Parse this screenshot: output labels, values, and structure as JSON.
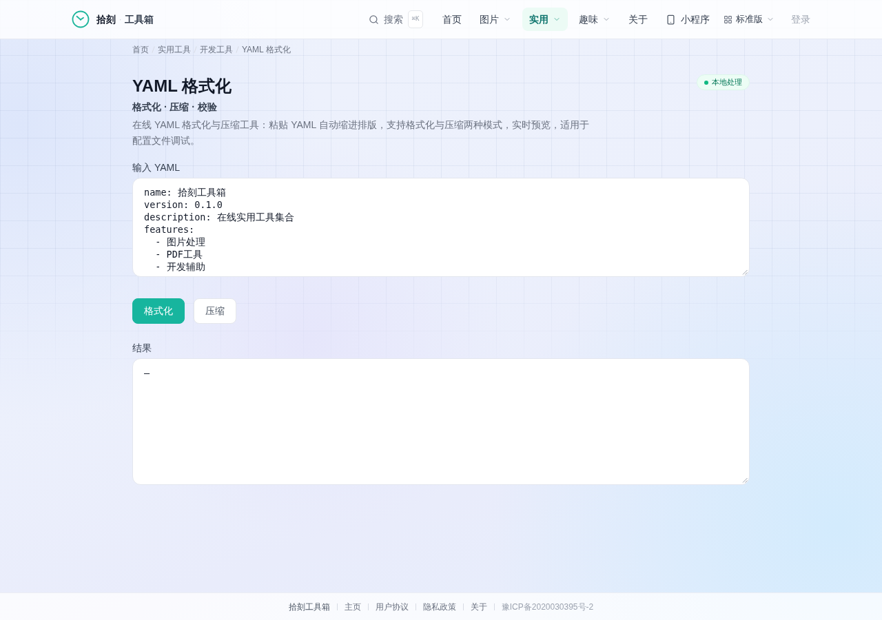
{
  "header": {
    "logo": {
      "name": "拾刻",
      "separator": "·",
      "subtitle": "工具箱"
    },
    "search": {
      "label": "搜索",
      "shortcut": "⌘K"
    },
    "nav": [
      {
        "label": "首页",
        "kind": "link",
        "selected": false
      },
      {
        "label": "图片",
        "kind": "dropdown",
        "selected": false
      },
      {
        "label": "实用",
        "kind": "dropdown",
        "selected": true
      },
      {
        "label": "趣味",
        "kind": "dropdown",
        "selected": false
      },
      {
        "label": "关于",
        "kind": "link",
        "selected": false
      }
    ],
    "mini_program": {
      "label": "小程序"
    },
    "edition_menu": {
      "label": "标准版"
    },
    "login": {
      "label": "登录"
    }
  },
  "breadcrumb": [
    "首页",
    "实用工具",
    "开发工具",
    "YAML 格式化"
  ],
  "tool": {
    "title": "YAML 格式化",
    "badge": "本地处理",
    "subtitle": "格式化 · 压缩 · 校验",
    "description": "在线 YAML 格式化与压缩工具：粘贴 YAML 自动缩进排版，支持格式化与压缩两种模式，实时预览，适用于配置文件调试。"
  },
  "input": {
    "label": "输入 YAML",
    "value": "name: 拾刻工具箱\nversion: 0.1.0\ndescription: 在线实用工具集合\nfeatures:\n  - 图片处理\n  - PDF工具\n  - 开发辅助"
  },
  "modes": [
    {
      "label": "格式化",
      "selected": true
    },
    {
      "label": "压缩",
      "selected": false
    }
  ],
  "result": {
    "label": "结果",
    "value": "—"
  },
  "footer": {
    "items": [
      {
        "label": "拾刻工具箱",
        "kind": "brand"
      },
      {
        "label": "主页",
        "kind": "link"
      },
      {
        "label": "用户协议",
        "kind": "link"
      },
      {
        "label": "隐私政策",
        "kind": "link"
      },
      {
        "label": "关于",
        "kind": "link"
      },
      {
        "label": "豫ICP备2020030395号-2",
        "kind": "record"
      }
    ]
  }
}
